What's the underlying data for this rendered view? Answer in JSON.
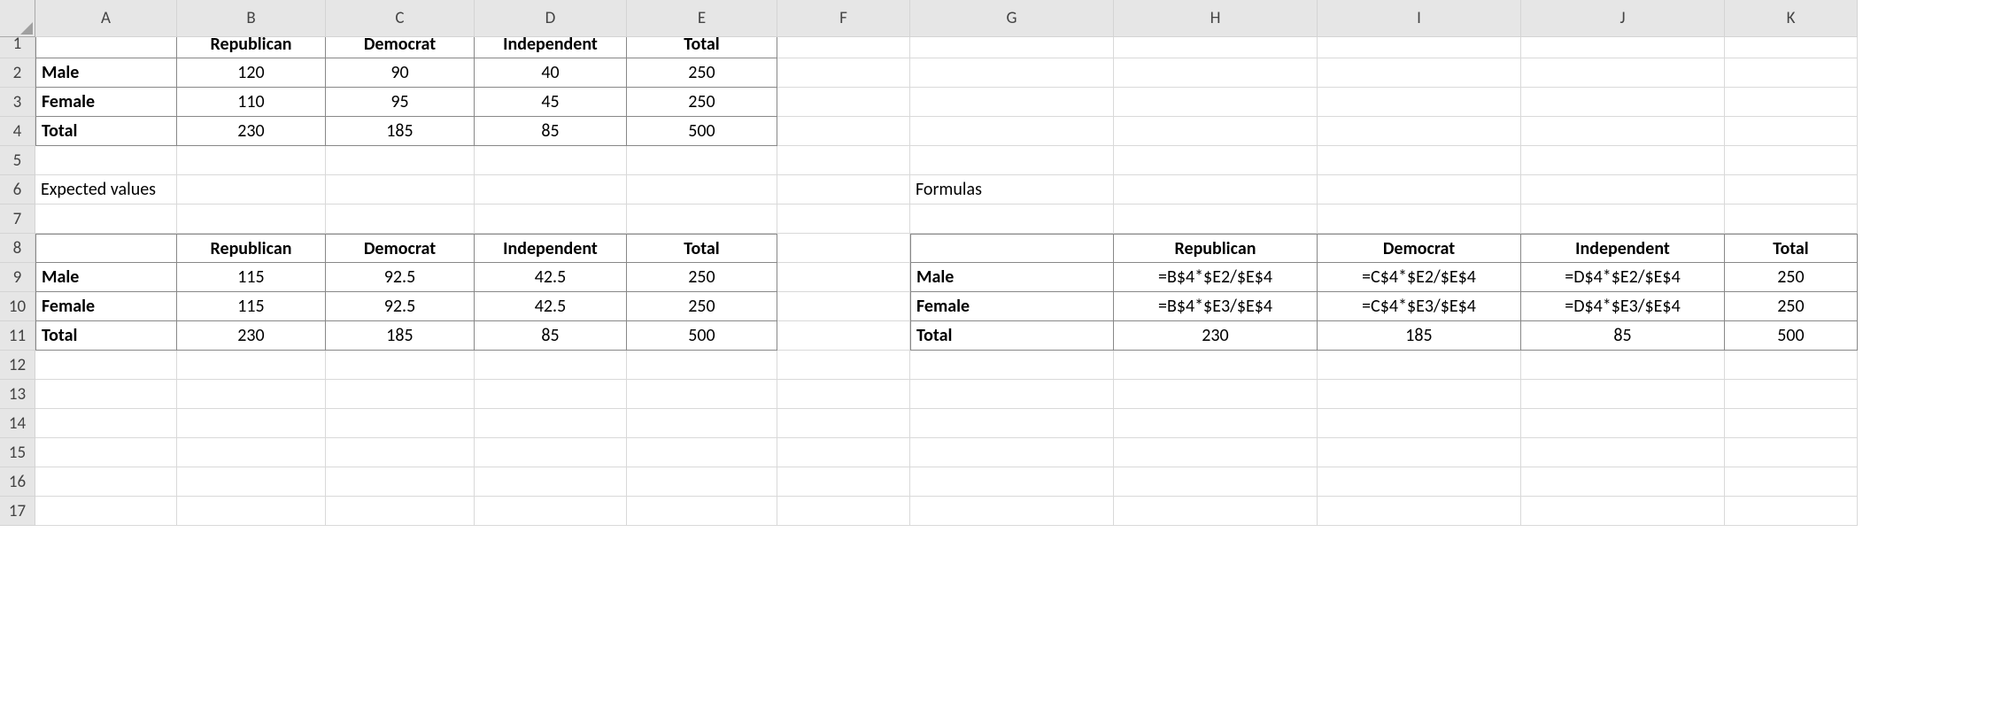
{
  "colHeaders": [
    "A",
    "B",
    "C",
    "D",
    "E",
    "F",
    "G",
    "H",
    "I",
    "J",
    "K"
  ],
  "rowHeaders": [
    "1",
    "2",
    "3",
    "4",
    "5",
    "6",
    "7",
    "8",
    "9",
    "10",
    "11",
    "12",
    "13",
    "14",
    "15",
    "16",
    "17"
  ],
  "table1": {
    "headers": [
      "Republican",
      "Democrat",
      "Independent",
      "Total"
    ],
    "rows": [
      {
        "label": "Male",
        "vals": [
          "120",
          "90",
          "40",
          "250"
        ]
      },
      {
        "label": "Female",
        "vals": [
          "110",
          "95",
          "45",
          "250"
        ]
      },
      {
        "label": "Total",
        "vals": [
          "230",
          "185",
          "85",
          "500"
        ]
      }
    ]
  },
  "labels": {
    "expected": "Expected values",
    "formulas": "Formulas"
  },
  "table2": {
    "headers": [
      "Republican",
      "Democrat",
      "Independent",
      "Total"
    ],
    "rows": [
      {
        "label": "Male",
        "vals": [
          "115",
          "92.5",
          "42.5",
          "250"
        ]
      },
      {
        "label": "Female",
        "vals": [
          "115",
          "92.5",
          "42.5",
          "250"
        ]
      },
      {
        "label": "Total",
        "vals": [
          "230",
          "185",
          "85",
          "500"
        ]
      }
    ]
  },
  "table3": {
    "headers": [
      "Republican",
      "Democrat",
      "Independent",
      "Total"
    ],
    "rows": [
      {
        "label": "Male",
        "vals": [
          "=B$4*$E2/$E$4",
          "=C$4*$E2/$E$4",
          "=D$4*$E2/$E$4",
          "250"
        ]
      },
      {
        "label": "Female",
        "vals": [
          "=B$4*$E3/$E$4",
          "=C$4*$E3/$E$4",
          "=D$4*$E3/$E$4",
          "250"
        ]
      },
      {
        "label": "Total",
        "vals": [
          "230",
          "185",
          "85",
          "500"
        ]
      }
    ]
  }
}
